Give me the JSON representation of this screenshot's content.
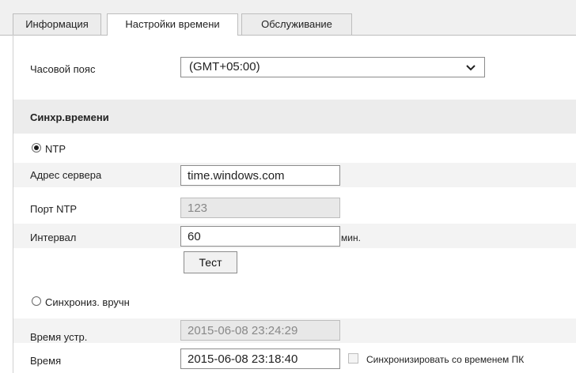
{
  "tabs": [
    {
      "label": "Информация",
      "active": false
    },
    {
      "label": "Настройки времени",
      "active": true
    },
    {
      "label": "Обслуживание",
      "active": false
    }
  ],
  "timezone": {
    "label": "Часовой пояс",
    "value": "(GMT+05:00)"
  },
  "sync": {
    "section_title": "Синхр.времени",
    "ntp": {
      "label": "NTP",
      "selected": true,
      "server_label": "Адрес сервера",
      "server_value": "time.windows.com",
      "port_label": "Порт NTP",
      "port_value": "123",
      "interval_label": "Интервал",
      "interval_value": "60",
      "interval_unit": "мин.",
      "test_button": "Тест"
    },
    "manual": {
      "label": "Синхрониз. вручн",
      "selected": false,
      "device_time_label": "Время устр.",
      "device_time_value": "2015-06-08 23:24:29",
      "time_label": "Время",
      "time_value": "2015-06-08 23:18:40",
      "pc_sync_label": "Синхронизировать со временем ПК",
      "pc_sync_checked": false
    }
  }
}
